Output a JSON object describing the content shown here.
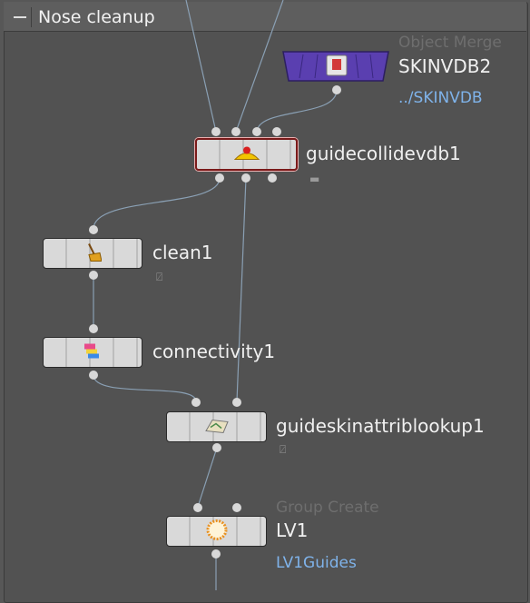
{
  "network_box": {
    "title": "Nose cleanup"
  },
  "nodes": {
    "skinvdb2": {
      "type_label": "Object Merge",
      "name": "SKINVDB2",
      "path": "../SKINVDB"
    },
    "guidecollidevdb1": {
      "name": "guidecollidevdb1"
    },
    "clean1": {
      "name": "clean1"
    },
    "connectivity1": {
      "name": "connectivity1"
    },
    "guideskinattriblookup1": {
      "name": "guideskinattriblookup1"
    },
    "lv1": {
      "type_label": "Group Create",
      "name": "LV1",
      "group": "LV1Guides"
    }
  },
  "colors": {
    "wire": "#8aa0b4",
    "object_merge": "#5a3fb0",
    "path_link": "#7fb3ea",
    "selection": "#7a1a1a"
  },
  "icons": {
    "skinvdb2": "object-merge-icon",
    "guidecollidevdb1": "collide-icon",
    "clean1": "broom-icon",
    "connectivity1": "connectivity-icon",
    "guideskinattriblookup1": "attrib-lookup-icon",
    "lv1": "group-create-icon"
  }
}
